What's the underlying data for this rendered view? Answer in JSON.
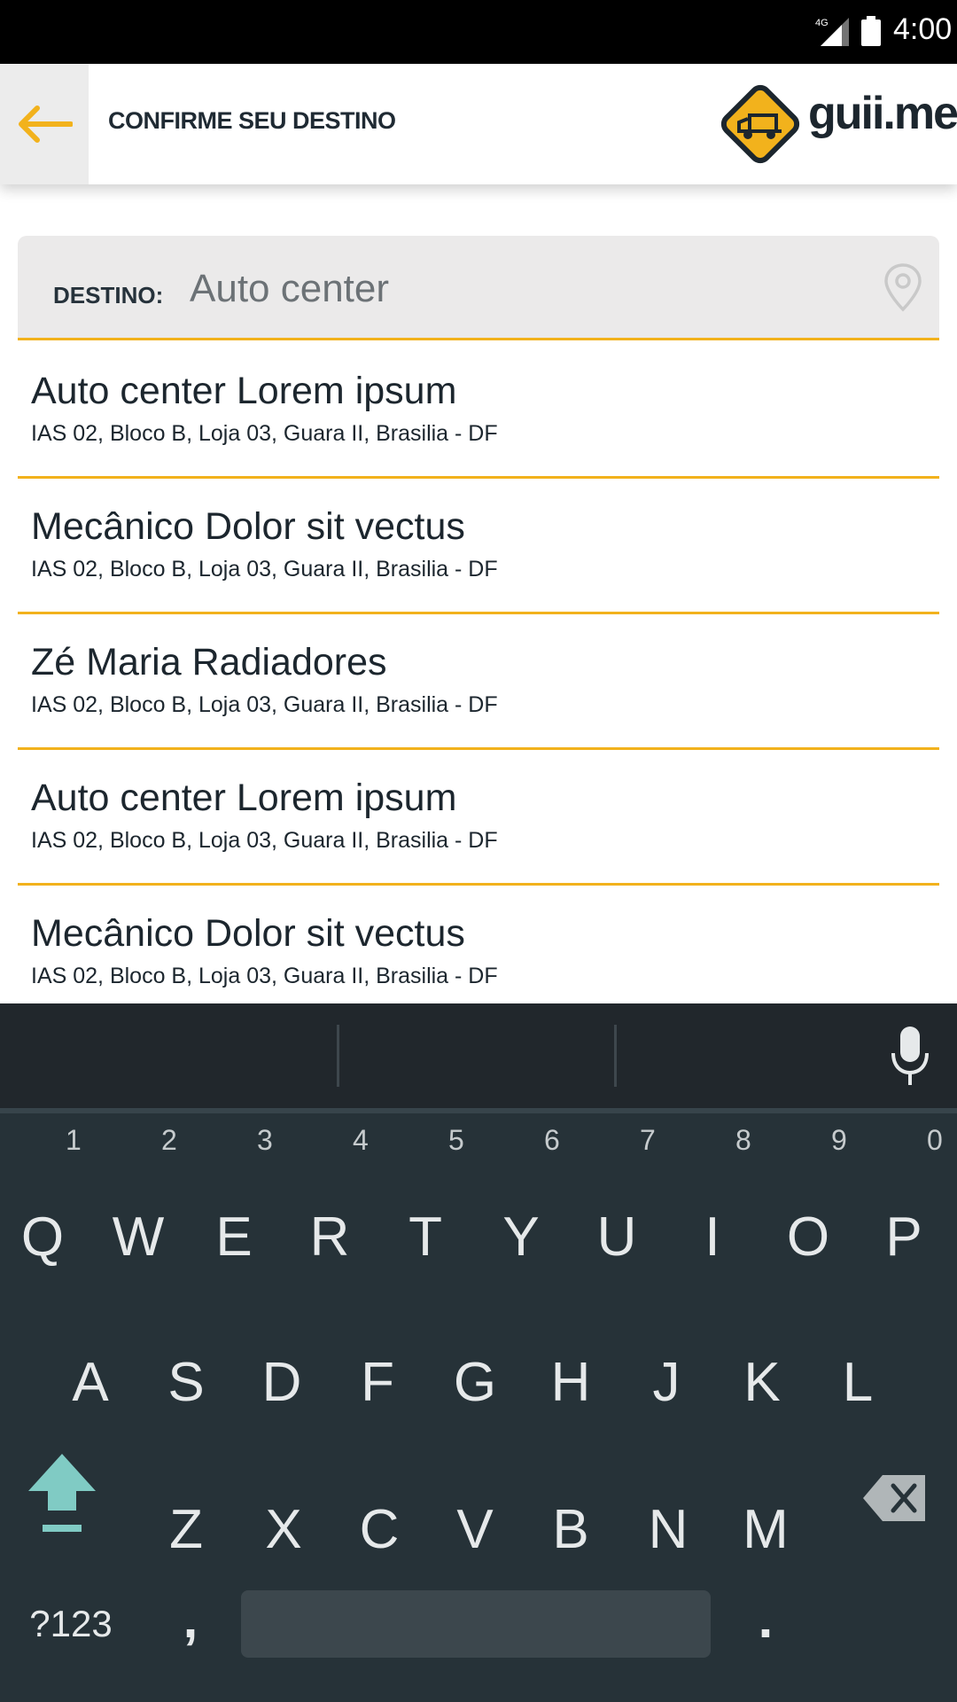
{
  "status_bar": {
    "network_label": "4G",
    "time": "4:00"
  },
  "header": {
    "back_icon": "arrow-left-icon",
    "title": "CONFIRME SEU DESTINO",
    "brand_name": "guii.me",
    "accent_color": "#f2b21c"
  },
  "search": {
    "label": "DESTINO:",
    "value": "Auto center",
    "location_icon": "map-pin-icon"
  },
  "results": [
    {
      "name": "Auto center Lorem ipsum",
      "address": "IAS 02, Bloco B, Loja 03,  Guara II, Brasilia - DF"
    },
    {
      "name": "Mecânico Dolor sit vectus",
      "address": "IAS 02, Bloco B, Loja 03,  Guara II, Brasilia - DF"
    },
    {
      "name": "Zé Maria Radiadores",
      "address": "IAS 02, Bloco B, Loja 03,  Guara II, Brasilia - DF"
    },
    {
      "name": "Auto center Lorem ipsum",
      "address": "IAS 02, Bloco B, Loja 03,  Guara II, Brasilia - DF"
    },
    {
      "name": "Mecânico Dolor sit vectus",
      "address": "IAS 02, Bloco B, Loja 03,  Guara II, Brasilia - DF"
    }
  ],
  "keyboard": {
    "row1": [
      "Q",
      "W",
      "E",
      "R",
      "T",
      "Y",
      "U",
      "I",
      "O",
      "P"
    ],
    "row1_hints": [
      "1",
      "2",
      "3",
      "4",
      "5",
      "6",
      "7",
      "8",
      "9",
      "0"
    ],
    "row2": [
      "A",
      "S",
      "D",
      "F",
      "G",
      "H",
      "J",
      "K",
      "L"
    ],
    "row3": [
      "Z",
      "X",
      "C",
      "V",
      "B",
      "N",
      "M"
    ],
    "symbols_label": "?123",
    "comma_label": ",",
    "period_label": "."
  }
}
